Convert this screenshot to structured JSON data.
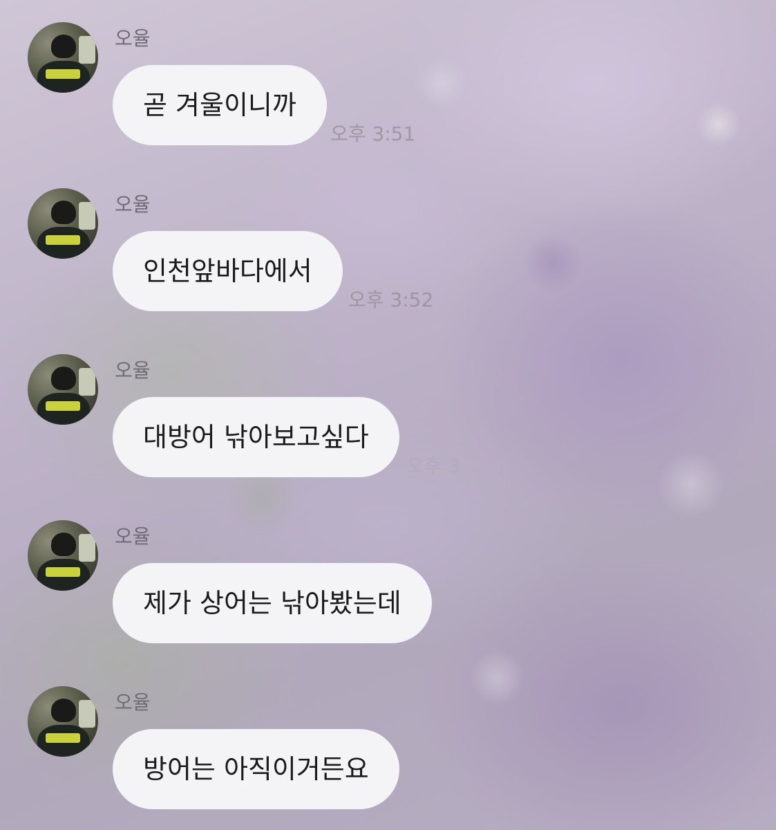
{
  "messages": [
    {
      "sender": "오율",
      "text": "곧 겨울이니까",
      "time": "오후 3:51"
    },
    {
      "sender": "오율",
      "text": "인천앞바다에서",
      "time": "오후 3:52"
    },
    {
      "sender": "오율",
      "text": "대방어 낚아보고싶다",
      "time": "오후 3"
    },
    {
      "sender": "오율",
      "text": "제가 상어는 낚아봤는데",
      "time": ""
    },
    {
      "sender": "오율",
      "text": "방어는 아직이거든요",
      "time": ""
    }
  ],
  "colors": {
    "bubble": "#f4f3f6",
    "name": "#6f6a76",
    "text": "#1a1a1c"
  }
}
